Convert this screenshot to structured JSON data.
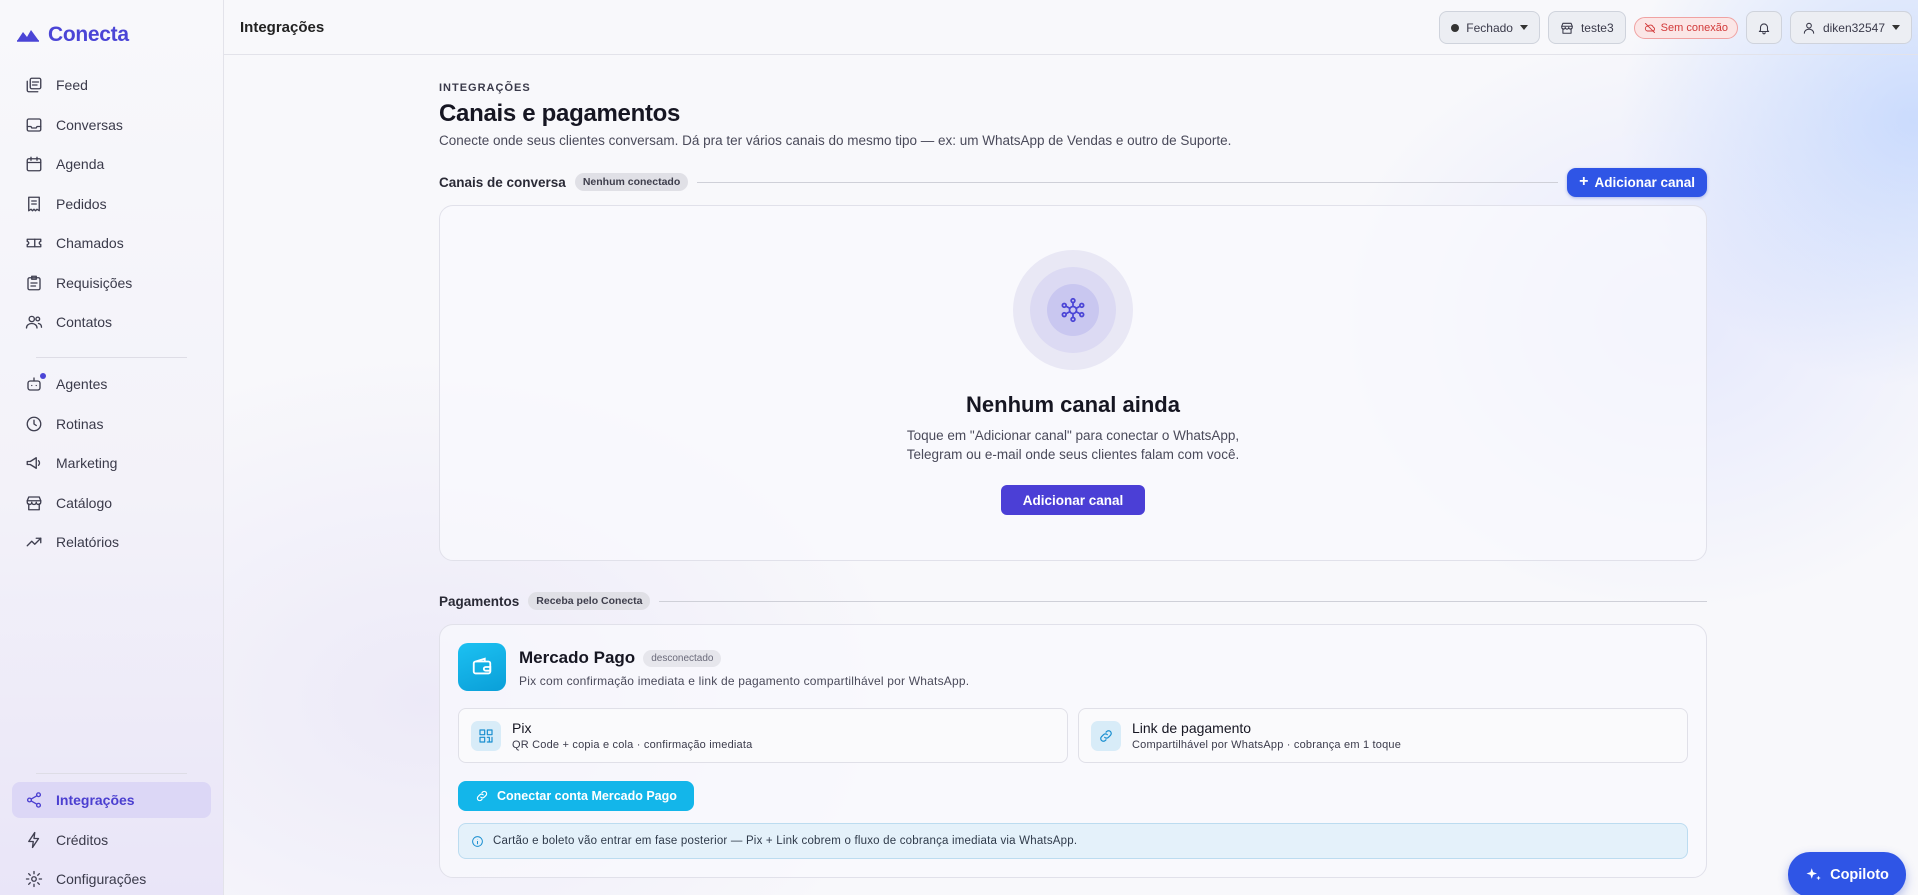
{
  "brand": {
    "name": "Conecta"
  },
  "sidebar": {
    "primary": [
      {
        "label": "Feed",
        "icon": "feed-icon"
      },
      {
        "label": "Conversas",
        "icon": "inbox-icon"
      },
      {
        "label": "Agenda",
        "icon": "calendar-icon"
      },
      {
        "label": "Pedidos",
        "icon": "receipt-icon"
      },
      {
        "label": "Chamados",
        "icon": "ticket-icon"
      },
      {
        "label": "Requisições",
        "icon": "clipboard-icon"
      },
      {
        "label": "Contatos",
        "icon": "users-icon"
      }
    ],
    "secondary": [
      {
        "label": "Agentes",
        "icon": "bot-icon"
      },
      {
        "label": "Rotinas",
        "icon": "clock-icon"
      },
      {
        "label": "Marketing",
        "icon": "megaphone-icon"
      },
      {
        "label": "Catálogo",
        "icon": "store-icon"
      },
      {
        "label": "Relatórios",
        "icon": "trend-icon"
      }
    ],
    "bottom": [
      {
        "label": "Integrações",
        "icon": "share-icon",
        "active": true
      },
      {
        "label": "Créditos",
        "icon": "bolt-icon"
      },
      {
        "label": "Configurações",
        "icon": "gear-icon"
      }
    ]
  },
  "topbar": {
    "title": "Integrações",
    "status": "Fechado",
    "store": "teste3",
    "connection": "Sem conexão",
    "user": "diken32547"
  },
  "page": {
    "eyebrow": "INTEGRAÇÕES",
    "title": "Canais e pagamentos",
    "description": "Conecte onde seus clientes conversam. Dá pra ter vários canais do mesmo tipo — ex: um WhatsApp de Vendas e outro de Suporte."
  },
  "channels": {
    "title": "Canais de conversa",
    "badge": "Nenhum conectado",
    "add_button": "Adicionar canal",
    "empty_title": "Nenhum canal ainda",
    "empty_line1": "Toque em \"Adicionar canal\" para conectar o WhatsApp,",
    "empty_line2": "Telegram ou e-mail onde seus clientes falam com você.",
    "empty_button": "Adicionar canal"
  },
  "payments": {
    "title": "Pagamentos",
    "badge": "Receba pelo Conecta",
    "provider": {
      "name": "Mercado Pago",
      "status": "desconectado",
      "description": "Pix com confirmação imediata e link de pagamento compartilhável por WhatsApp."
    },
    "options": [
      {
        "title": "Pix",
        "desc": "QR Code + copia e cola · confirmação imediata",
        "icon": "qr-icon"
      },
      {
        "title": "Link de pagamento",
        "desc": "Compartilhável por WhatsApp · cobrança em 1 toque",
        "icon": "link-icon"
      }
    ],
    "connect_button": "Conectar conta Mercado Pago",
    "info": "Cartão e boleto vão entrar em fase posterior — Pix + Link cobrem o fluxo de cobrança imediata via WhatsApp."
  },
  "copilot": {
    "label": "Copiloto"
  },
  "colors": {
    "accent": "#4b45d6",
    "primary": "#2f55e6",
    "cyan": "#13b6ea",
    "danger": "#d23a3a"
  }
}
